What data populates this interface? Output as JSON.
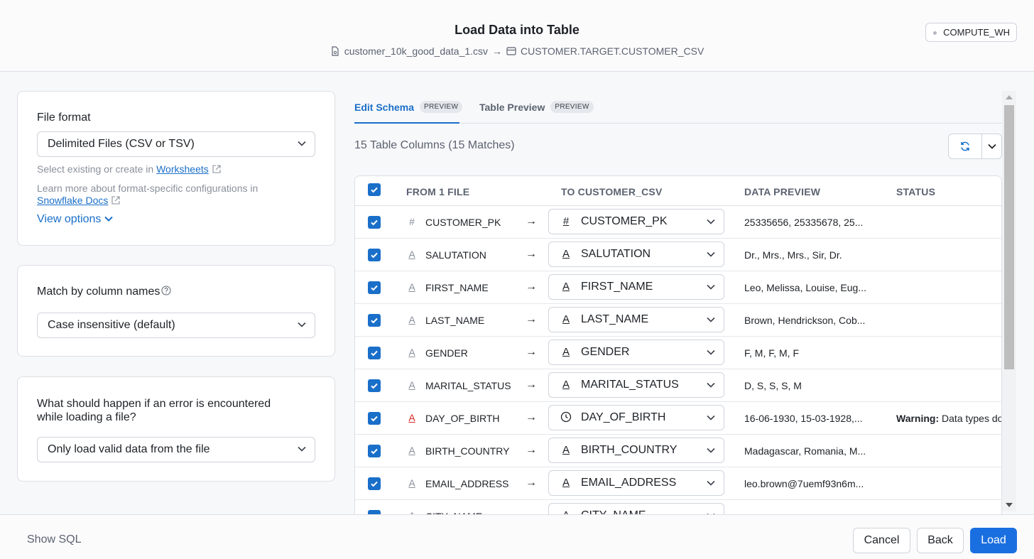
{
  "header": {
    "title": "Load Data into Table",
    "source_file": "customer_10k_good_data_1.csv",
    "arrow": "→",
    "target_table": "CUSTOMER.TARGET.CUSTOMER_CSV",
    "warehouse": "COMPUTE_WH"
  },
  "left": {
    "file_format": {
      "label": "File format",
      "value": "Delimited Files (CSV or TSV)",
      "hint_prefix": "Select existing or create in ",
      "hint_link": "Worksheets",
      "learn_prefix": "Learn more about format-specific configurations in",
      "learn_link": "Snowflake Docs",
      "view_options": "View options"
    },
    "match": {
      "label": "Match by column names",
      "value": "Case insensitive (default)"
    },
    "on_error": {
      "label_line1": "What should happen if an error is encountered",
      "label_line2": "while loading a file?",
      "value": "Only load valid data from the file"
    }
  },
  "tabs": [
    {
      "label": "Edit Schema",
      "badge": "PREVIEW"
    },
    {
      "label": "Table Preview",
      "badge": "PREVIEW"
    }
  ],
  "column_count": "15 Table Columns (15 Matches)",
  "table": {
    "headers": [
      "FROM 1 FILE",
      "TO CUSTOMER_CSV",
      "DATA PREVIEW",
      "STATUS"
    ],
    "rows": [
      {
        "src_icon": "#",
        "src": "CUSTOMER_PK",
        "tgt_icon": "#",
        "tgt": "CUSTOMER_PK",
        "preview": "25335656, 25335678, 25...",
        "status_bold": "",
        "status": ""
      },
      {
        "src_icon": "A",
        "src": "SALUTATION",
        "tgt_icon": "A",
        "tgt": "SALUTATION",
        "preview": "Dr., Mrs., Mrs., Sir, Dr.",
        "status_bold": "",
        "status": ""
      },
      {
        "src_icon": "A",
        "src": "FIRST_NAME",
        "tgt_icon": "A",
        "tgt": "FIRST_NAME",
        "preview": "Leo, Melissa, Louise, Eug...",
        "status_bold": "",
        "status": ""
      },
      {
        "src_icon": "A",
        "src": "LAST_NAME",
        "tgt_icon": "A",
        "tgt": "LAST_NAME",
        "preview": "Brown, Hendrickson, Cob...",
        "status_bold": "",
        "status": ""
      },
      {
        "src_icon": "A",
        "src": "GENDER",
        "tgt_icon": "A",
        "tgt": "GENDER",
        "preview": "F, M, F, M, F",
        "status_bold": "",
        "status": ""
      },
      {
        "src_icon": "A",
        "src": "MARITAL_STATUS",
        "tgt_icon": "A",
        "tgt": "MARITAL_STATUS",
        "preview": "D, S, S, S, M",
        "status_bold": "",
        "status": ""
      },
      {
        "src_icon": "A",
        "src": "DAY_OF_BIRTH",
        "tgt_icon": "clock",
        "tgt": "DAY_OF_BIRTH",
        "preview": "16-06-1930, 15-03-1928,...",
        "status_bold": "Warning:",
        "status": " Data types do"
      },
      {
        "src_icon": "A",
        "src": "BIRTH_COUNTRY",
        "tgt_icon": "A",
        "tgt": "BIRTH_COUNTRY",
        "preview": "Madagascar, Romania, M...",
        "status_bold": "",
        "status": ""
      },
      {
        "src_icon": "A",
        "src": "EMAIL_ADDRESS",
        "tgt_icon": "A",
        "tgt": "EMAIL_ADDRESS",
        "preview": "leo.brown@7uemf93n6m...",
        "status_bold": "",
        "status": ""
      },
      {
        "src_icon": "A",
        "src": "CITY_NAME",
        "tgt_icon": "A",
        "tgt": "CITY_NAME",
        "preview": "",
        "status_bold": "",
        "status": ""
      }
    ]
  },
  "footer": {
    "show_sql": "Show SQL",
    "cancel": "Cancel",
    "back": "Back",
    "load": "Load"
  },
  "colors": {
    "accent": "#1a6fc9",
    "primary_button": "#1a6fe0",
    "warning_icon": "#d22b2b"
  }
}
